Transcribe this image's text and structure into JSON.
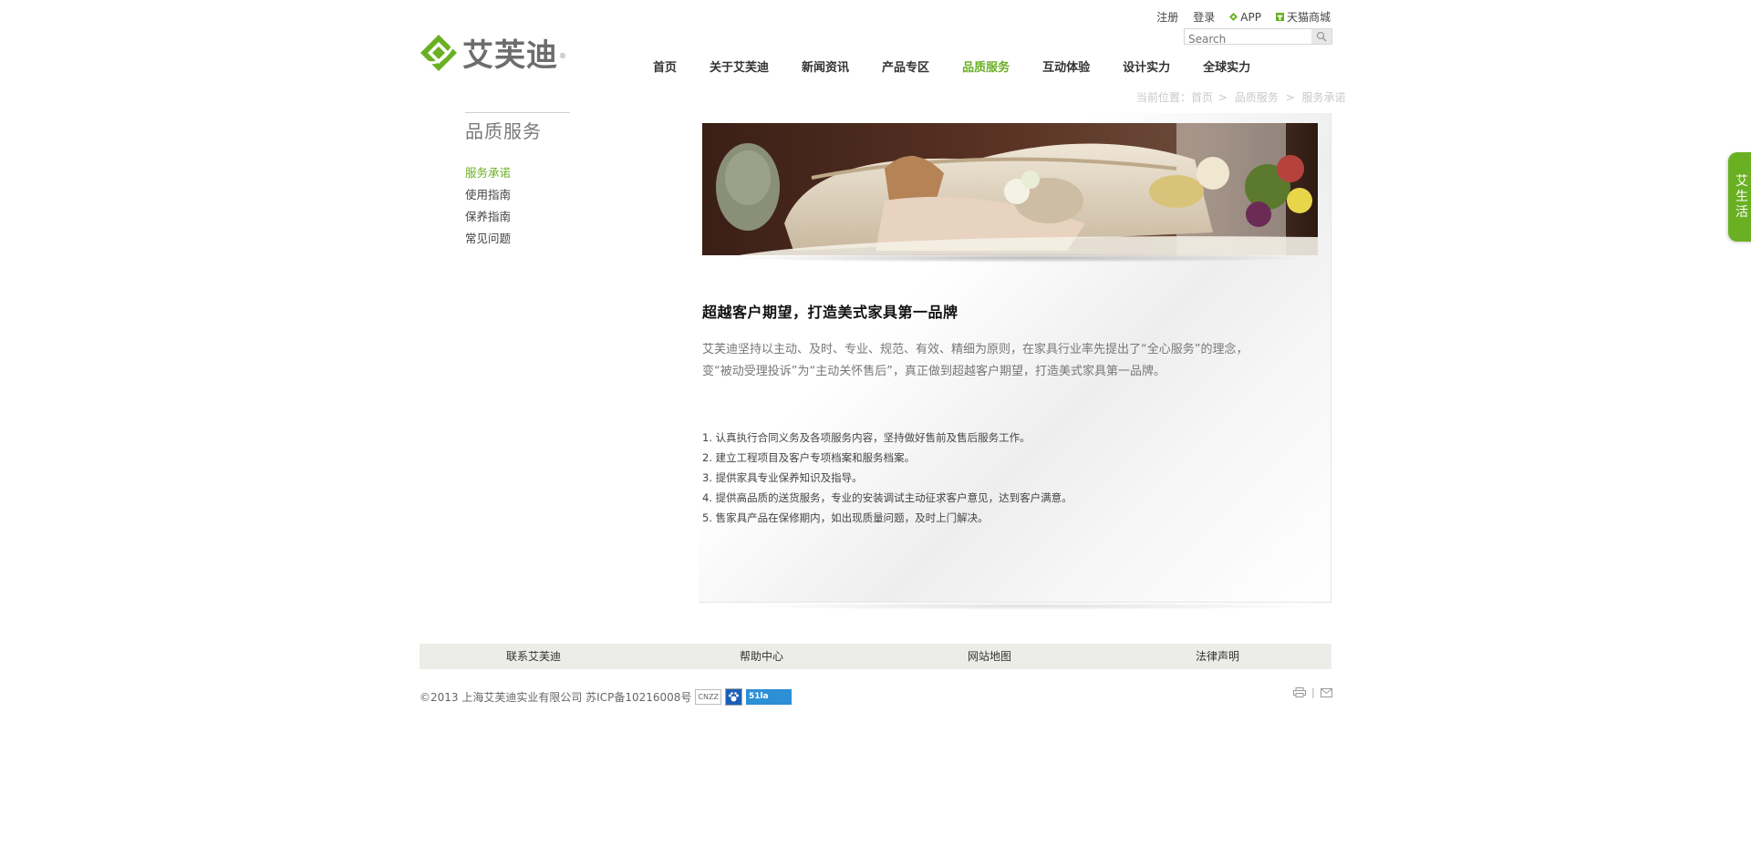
{
  "brand": {
    "name": "艾芙迪",
    "reg_mark": "®",
    "green": "#6ab023"
  },
  "top_links": {
    "register": "注册",
    "login": "登录",
    "app": "APP",
    "tmall": "天猫商城"
  },
  "search": {
    "placeholder": "Search",
    "icon": "search-icon"
  },
  "nav": {
    "items": [
      "首页",
      "关于艾芙迪",
      "新闻资讯",
      "产品专区",
      "品质服务",
      "互动体验",
      "设计实力",
      "全球实力"
    ],
    "active": "品质服务"
  },
  "breadcrumb": {
    "prefix": "当前位置：",
    "home": "首页",
    "sep": ">",
    "section": "品质服务",
    "page": "服务承诺"
  },
  "sidebar": {
    "title": "品质服务",
    "items": [
      "服务承诺",
      "使用指南",
      "保养指南",
      "常见问题"
    ],
    "current": "服务承诺"
  },
  "content": {
    "title": "超越客户期望，打造美式家具第一品牌",
    "intro": "艾芙迪坚持以主动、及时、专业、规范、有效、精细为原则，在家具行业率先提出了“全心服务”的理念，变“被动受理投诉”为“主动关怀售后”，真正做到超越客户期望，打造美式家具第一品牌。",
    "list": [
      "1. 认真执行合同义务及各项服务内容，坚持做好售前及售后服务工作。",
      "2. 建立工程项目及客户专项档案和服务档案。",
      "3. 提供家具专业保养知识及指导。",
      "4. 提供高品质的送货服务，专业的安装调试主动征求客户意见，达到客户满意。",
      "5. 售家具产品在保修期内，如出现质量问题，及时上门解决。"
    ]
  },
  "footer": {
    "links": [
      "联系艾芙迪",
      "帮助中心",
      "网站地图",
      "法律声明"
    ],
    "copyright": "©2013 上海艾芙迪实业有限公司 苏ICP备10216008号",
    "badges": [
      "CNZZ",
      "51la"
    ],
    "icon_sep": "|"
  },
  "side_tab": {
    "chars": [
      "艾",
      "生",
      "活"
    ]
  }
}
